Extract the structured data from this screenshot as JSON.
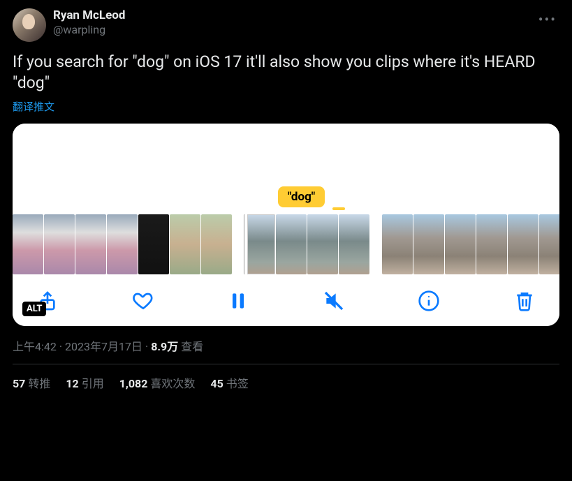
{
  "author": {
    "display_name": "Ryan McLeod",
    "handle": "@warpling"
  },
  "body": "If you search for \"dog\" on iOS 17 it'll also show you clips where it's HEARD \"dog\"",
  "translate_label": "翻译推文",
  "media": {
    "tag": "\"dog\"",
    "alt_label": "ALT"
  },
  "meta": {
    "time": "上午4:42",
    "date": "2023年7月17日",
    "views_count": "8.9万",
    "views_label": "查看"
  },
  "stats": {
    "retweets_count": "57",
    "retweets_label": "转推",
    "quotes_count": "12",
    "quotes_label": "引用",
    "likes_count": "1,082",
    "likes_label": "喜欢次数",
    "bookmarks_count": "45",
    "bookmarks_label": "书签"
  }
}
